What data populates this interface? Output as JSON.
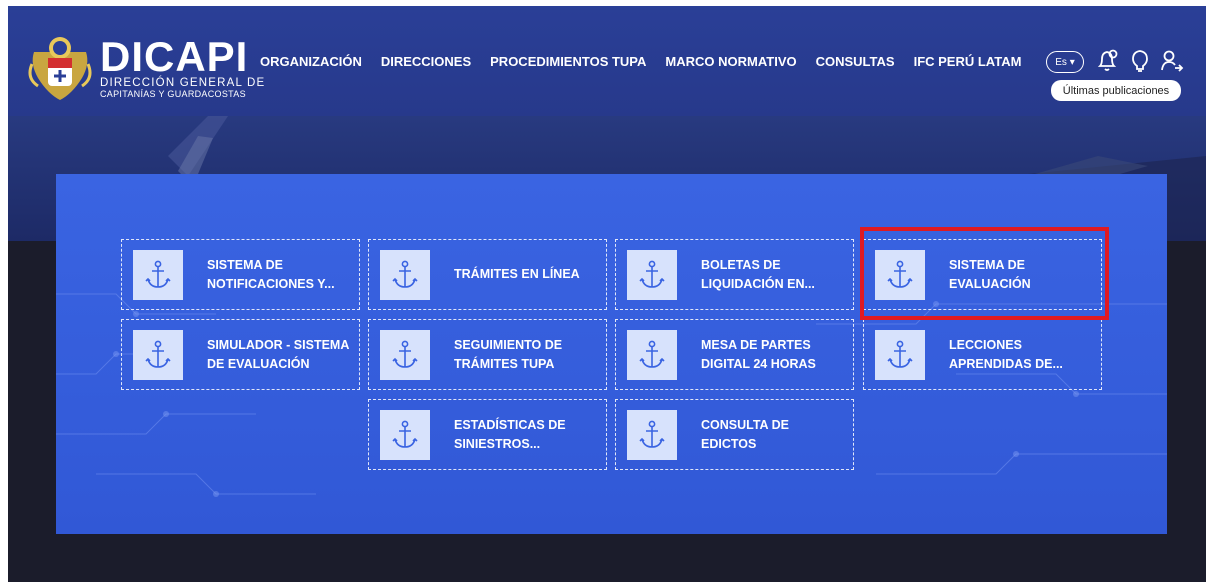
{
  "brand": {
    "title": "DICAPI",
    "sub1": "DIRECCIÓN GENERAL DE",
    "sub2": "CAPITANÍAS Y GUARDACOSTAS"
  },
  "nav": [
    "ORGANIZACIÓN",
    "DIRECCIONES",
    "PROCEDIMIENTOS TUPA",
    "MARCO NORMATIVO",
    "CONSULTAS",
    "IFC PERÚ LATAM"
  ],
  "header": {
    "lang": "Es ▾",
    "tooltip": "Últimas publicaciones",
    "icons": [
      "bell-icon",
      "lightbulb-icon",
      "user-login-icon"
    ]
  },
  "cards": [
    {
      "line1": "SISTEMA DE",
      "line2": "NOTIFICACIONES Y...",
      "icon": "anchor-icon"
    },
    {
      "line1": "TRÁMITES EN LÍNEA",
      "line2": "",
      "icon": "anchor-icon"
    },
    {
      "line1": "BOLETAS DE",
      "line2": "LIQUIDACIÓN EN...",
      "icon": "anchor-icon"
    },
    {
      "line1": "SISTEMA DE",
      "line2": "EVALUACIÓN",
      "icon": "anchor-icon"
    },
    {
      "line1": "SIMULADOR - SISTEMA",
      "line2": "DE EVALUACIÓN",
      "icon": "anchor-icon"
    },
    {
      "line1": "SEGUIMIENTO DE",
      "line2": "TRÁMITES TUPA",
      "icon": "anchor-icon"
    },
    {
      "line1": "MESA DE PARTES",
      "line2": "DIGITAL 24 HORAS",
      "icon": "anchor-icon"
    },
    {
      "line1": "LECCIONES",
      "line2": "APRENDIDAS DE...",
      "icon": "anchor-icon"
    },
    {
      "line1": "ESTADÍSTICAS DE",
      "line2": "SINIESTROS...",
      "icon": "anchor-icon"
    },
    {
      "line1": "CONSULTA DE",
      "line2": "EDICTOS",
      "icon": "anchor-icon"
    }
  ],
  "colors": {
    "header": "#27398b",
    "panel": "#3a64e2",
    "highlight": "#e01a22",
    "tile": "#d7e2fc"
  }
}
